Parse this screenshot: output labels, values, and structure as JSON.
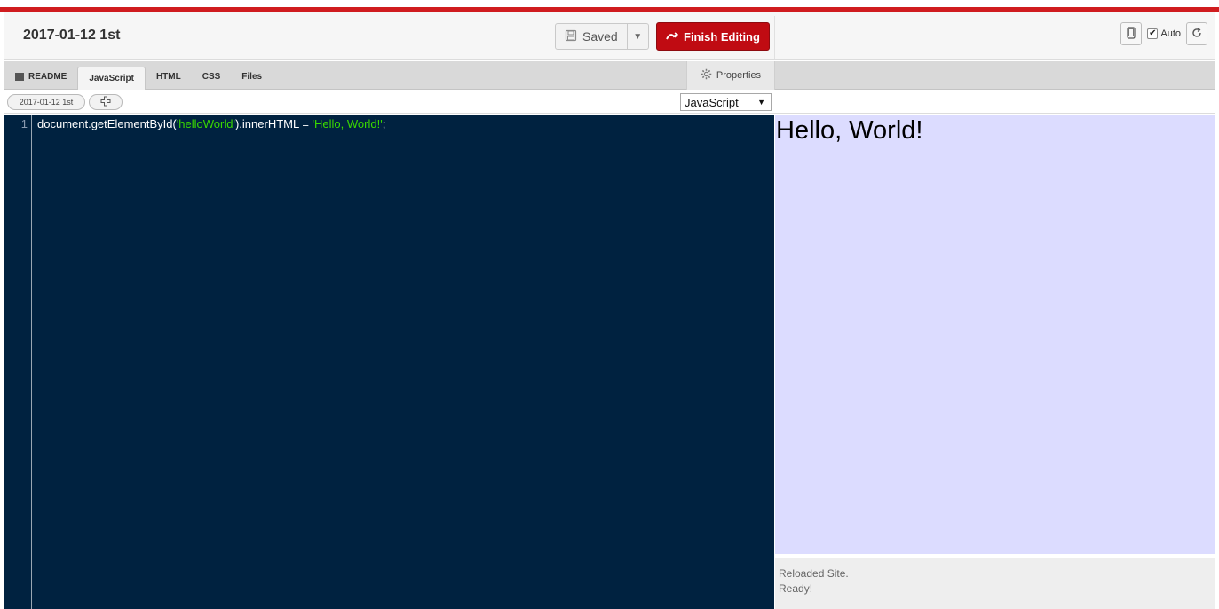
{
  "header": {
    "title": "2017-01-12 1st",
    "saved_label": "Saved",
    "finish_label": "Finish Editing",
    "auto_label": "Auto",
    "auto_checked": true
  },
  "tabs": [
    {
      "label": "README",
      "active": false
    },
    {
      "label": "JavaScript",
      "active": true
    },
    {
      "label": "HTML",
      "active": false
    },
    {
      "label": "CSS",
      "active": false
    },
    {
      "label": "Files",
      "active": false
    }
  ],
  "properties_label": "Properties",
  "subbar": {
    "version_label": "2017-01-12 1st",
    "add_label": "+",
    "language_selected": "JavaScript"
  },
  "editor": {
    "line_number": "1",
    "code": {
      "part1": "document.getElementById(",
      "str1": "'helloWorld'",
      "part2": ").innerHTML = ",
      "str2": "'Hello, World!'",
      "part3": ";"
    }
  },
  "preview": {
    "heading": "Hello, World!"
  },
  "console": {
    "line1": "Reloaded Site.",
    "line2": "Ready!"
  },
  "colors": {
    "accent_red": "#d01c1f",
    "finish_button": "#c00b12",
    "editor_bg": "#002240",
    "string_color": "#3ad900",
    "preview_bg": "#dcdcff"
  },
  "icons": [
    "save-icon",
    "dropdown-caret-icon",
    "finish-arrow-icon",
    "phone-icon",
    "reload-icon",
    "readme-icon",
    "gear-icon",
    "add-icon"
  ]
}
